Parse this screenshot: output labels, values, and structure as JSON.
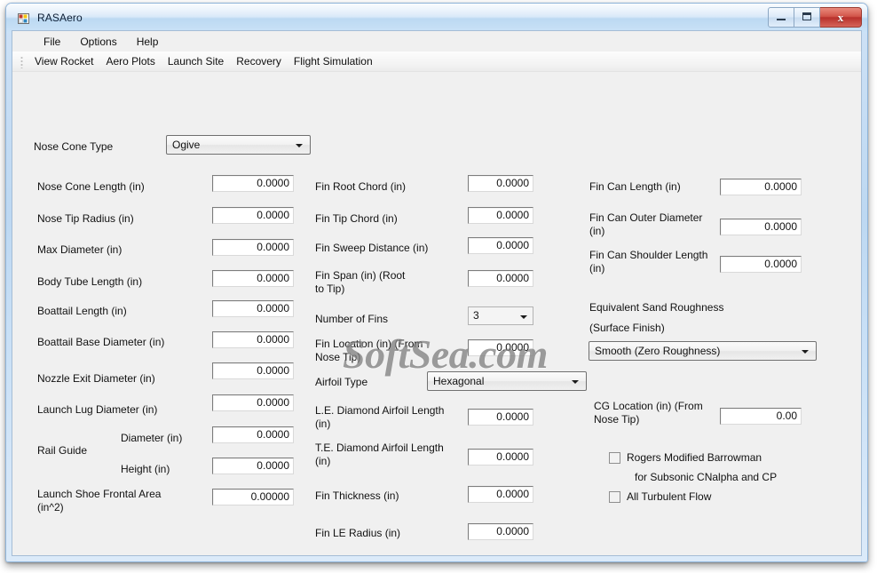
{
  "window": {
    "title": "RASAero",
    "icon": "app-grid-icon",
    "caption_buttons": {
      "minimize": "minimize-icon",
      "maximize": "maximize-icon",
      "close": "x"
    }
  },
  "menubar": {
    "items": [
      {
        "label": "File"
      },
      {
        "label": "Options"
      },
      {
        "label": "Help"
      }
    ]
  },
  "toolstrip": {
    "items": [
      {
        "label": "View Rocket"
      },
      {
        "label": "Aero Plots"
      },
      {
        "label": "Launch Site"
      },
      {
        "label": "Recovery"
      },
      {
        "label": "Flight Simulation"
      }
    ]
  },
  "watermark": {
    "text": "SoftSea.com"
  },
  "form": {
    "nose_cone_type": {
      "label": "Nose Cone Type",
      "value": "Ogive"
    },
    "left_column": [
      {
        "label": "Nose Cone Length (in)",
        "value": "0.0000"
      },
      {
        "label": "Nose Tip Radius (in)",
        "value": "0.0000"
      },
      {
        "label": "Max Diameter (in)",
        "value": "0.0000"
      },
      {
        "label": "Body Tube Length (in)",
        "value": "0.0000"
      },
      {
        "label": "Boattail Length (in)",
        "value": "0.0000"
      },
      {
        "label": "Boattail Base Diameter (in)",
        "value": "0.0000"
      },
      {
        "label": "Nozzle Exit Diameter (in)",
        "value": "0.0000"
      },
      {
        "label": "Launch Lug Diameter (in)",
        "value": "0.0000"
      }
    ],
    "rail_guide": {
      "group_label": "Rail Guide",
      "diameter_label": "Diameter (in)",
      "diameter_value": "0.0000",
      "height_label": "Height (in)",
      "height_value": "0.0000"
    },
    "launch_shoe": {
      "label": "Launch Shoe Frontal Area\n(in^2)",
      "value": "0.00000"
    },
    "middle_column": [
      {
        "label": "Fin Root Chord (in)",
        "value": "0.0000"
      },
      {
        "label": "Fin Tip Chord (in)",
        "value": "0.0000"
      },
      {
        "label": "Fin Sweep Distance (in)",
        "value": "0.0000"
      },
      {
        "label": "Fin Span (in)  (Root\nto Tip)",
        "value": "0.0000"
      }
    ],
    "number_of_fins": {
      "label": "Number of Fins",
      "value": "3"
    },
    "fin_location": {
      "label": "Fin Location (in) (From\nNose Tip)",
      "value": "0.0000"
    },
    "airfoil_type": {
      "label": "Airfoil Type",
      "value": "Hexagonal"
    },
    "middle_column_lower": [
      {
        "label": "L.E. Diamond Airfoil Length\n(in)",
        "value": "0.0000"
      },
      {
        "label": "T.E. Diamond Airfoil Length\n(in)",
        "value": "0.0000"
      },
      {
        "label": "Fin Thickness (in)",
        "value": "0.0000"
      },
      {
        "label": "Fin LE Radius (in)",
        "value": "0.0000"
      }
    ],
    "right_column": [
      {
        "label": "Fin Can Length (in)",
        "value": "0.0000"
      },
      {
        "label": "Fin Can Outer Diameter\n(in)",
        "value": "0.0000"
      },
      {
        "label": "Fin Can Shoulder Length\n(in)",
        "value": "0.0000"
      }
    ],
    "sand_roughness": {
      "label_line1": "Equivalent Sand Roughness",
      "label_line2": "(Surface Finish)",
      "value": "Smooth (Zero Roughness)"
    },
    "cg_location": {
      "label": "CG Location (in) (From\nNose Tip)",
      "value": "0.00"
    },
    "checkboxes": [
      {
        "label": "Rogers Modified Barrowman",
        "checked": false
      },
      {
        "label": "All Turbulent Flow",
        "checked": false
      }
    ],
    "checkbox_continuation": "for Subsonic CNalpha and CP"
  }
}
